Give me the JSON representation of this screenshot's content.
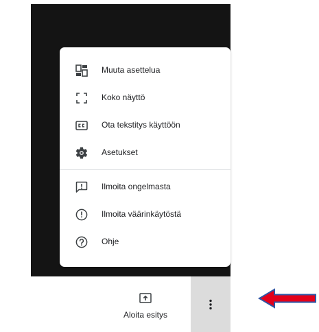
{
  "menu": {
    "items": [
      {
        "label": "Muuta asettelua",
        "icon": "change-layout-icon"
      },
      {
        "label": "Koko näyttö",
        "icon": "fullscreen-icon"
      },
      {
        "label": "Ota tekstitys käyttöön",
        "icon": "closed-captions-icon"
      },
      {
        "label": "Asetukset",
        "icon": "gear-icon"
      },
      {
        "label": "Ilmoita ongelmasta",
        "icon": "report-problem-icon"
      },
      {
        "label": "Ilmoita väärinkäytöstä",
        "icon": "report-abuse-icon"
      },
      {
        "label": "Ohje",
        "icon": "help-icon"
      }
    ]
  },
  "bottom_bar": {
    "present_label": "Aloita esitys",
    "present_icon": "present-screen-icon",
    "more_icon": "more-vert-icon"
  },
  "annotation": {
    "arrow_icon": "red-arrow-left-icon",
    "arrow_color": "#e3001b"
  },
  "colors": {
    "video_background": "#141414",
    "menu_background": "#ffffff",
    "icon_color": "#3c4043",
    "more_button_background": "#dcdcdc"
  }
}
